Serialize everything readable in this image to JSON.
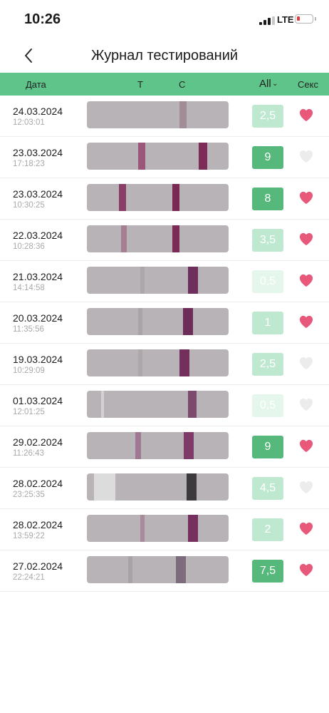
{
  "status_bar": {
    "time": "10:26",
    "network": "LTE"
  },
  "nav": {
    "title": "Журнал тестирований"
  },
  "columns": {
    "date": "Дата",
    "t": "T",
    "c": "C",
    "filter": "All",
    "sex": "Секс"
  },
  "colors": {
    "header_green": "#5fc48a",
    "heart_on": "#e8587a",
    "heart_off": "#ececec",
    "score_dark": "#56b87a",
    "score_light": "#bfe8d1",
    "score_faint": "#e5f6ec"
  },
  "rows": [
    {
      "date": "24.03.2024",
      "time": "12:03:01",
      "score": "2,5",
      "sex": true
    },
    {
      "date": "23.03.2024",
      "time": "17:18:23",
      "score": "9",
      "sex": false
    },
    {
      "date": "23.03.2024",
      "time": "10:30:25",
      "score": "8",
      "sex": true
    },
    {
      "date": "22.03.2024",
      "time": "10:28:36",
      "score": "3,5",
      "sex": true
    },
    {
      "date": "21.03.2024",
      "time": "14:14:58",
      "score": "0,5",
      "sex": true
    },
    {
      "date": "20.03.2024",
      "time": "11:35:56",
      "score": "1",
      "sex": true
    },
    {
      "date": "19.03.2024",
      "time": "10:29:09",
      "score": "2,5",
      "sex": false
    },
    {
      "date": "01.03.2024",
      "time": "12:01:25",
      "score": "0,5",
      "sex": false
    },
    {
      "date": "29.02.2024",
      "time": "11:26:43",
      "score": "9",
      "sex": true
    },
    {
      "date": "28.02.2024",
      "time": "23:25:35",
      "score": "4,5",
      "sex": false
    },
    {
      "date": "28.02.2024",
      "time": "13:59:22",
      "score": "2",
      "sex": true
    },
    {
      "date": "27.02.2024",
      "time": "22:24:21",
      "score": "7,5",
      "sex": true
    }
  ]
}
